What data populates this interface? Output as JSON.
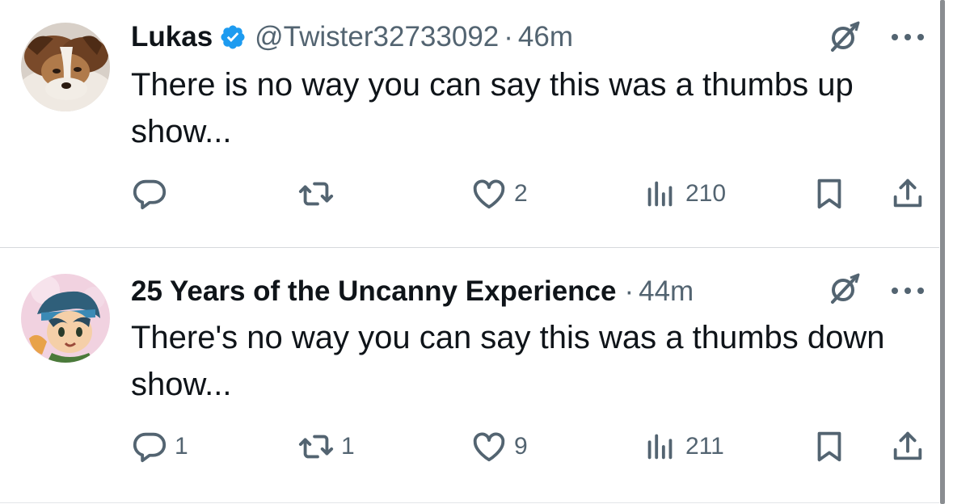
{
  "tweets": [
    {
      "name": "Lukas",
      "verified": true,
      "handle": "@Twister32733092",
      "separator": "·",
      "time": "46m",
      "text": "There is no way you can say this was a thumbs up show...",
      "replies": "",
      "reposts": "",
      "likes": "2",
      "views": "210"
    },
    {
      "name": "25 Years of the Uncanny Experience",
      "verified": false,
      "handle": "",
      "separator": "·",
      "time": "44m",
      "text": "There's no way you can say this was a thumbs down show...",
      "replies": "1",
      "reposts": "1",
      "likes": "9",
      "views": "211"
    }
  ],
  "icons": {
    "reply": "reply-icon",
    "repost": "repost-icon",
    "like": "heart-icon",
    "views": "views-icon",
    "bookmark": "bookmark-icon",
    "share": "share-icon",
    "grok": "grok-icon",
    "more": "more-icon",
    "verified": "verified-badge-icon"
  },
  "colors": {
    "text": "#0f1419",
    "secondary": "#536471",
    "verified": "#1d9bf0",
    "divider": "#d6d9dc"
  }
}
